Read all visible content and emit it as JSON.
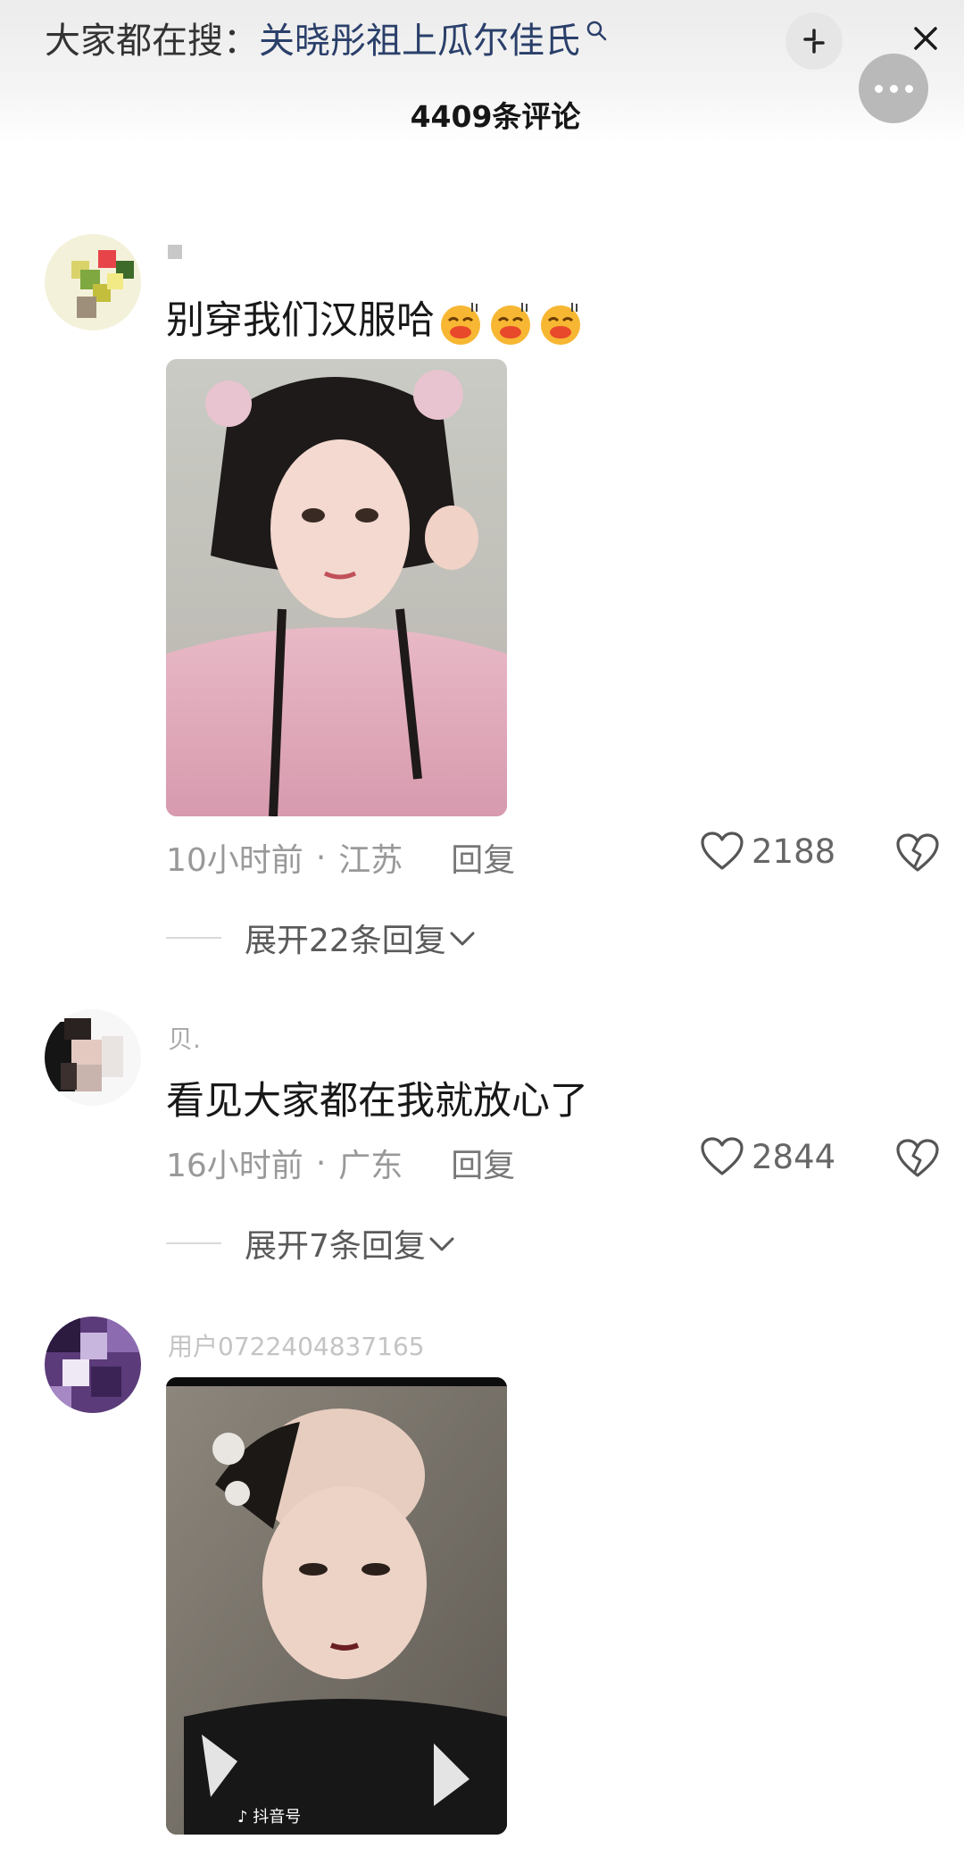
{
  "header": {
    "search_prefix": "大家都在搜：",
    "search_term": "关晓彤祖上瓜尔佳氏",
    "comment_count": "4409条评论"
  },
  "comments": [
    {
      "username": "",
      "text": "别穿我们汉服哈",
      "time": "10小时前",
      "location": "江苏",
      "reply_label": "回复",
      "likes": "2188",
      "expand_label": "展开22条回复"
    },
    {
      "username": "贝.",
      "text": "看见大家都在我就放心了",
      "time": "16小时前",
      "location": "广东",
      "reply_label": "回复",
      "likes": "2844",
      "expand_label": "展开7条回复"
    },
    {
      "username": "用户0722404837165",
      "watermark": "抖音号"
    }
  ],
  "colors": {
    "search_term": "#2a3f6a",
    "meta": "#999999",
    "background": "#ffffff"
  }
}
